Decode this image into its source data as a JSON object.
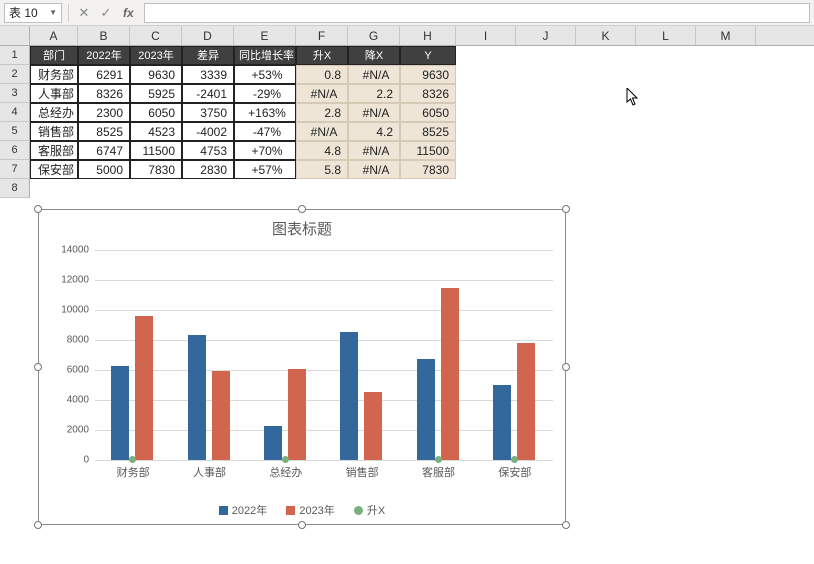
{
  "toolbar": {
    "name_box": "表 10",
    "cancel_icon": "✕",
    "confirm_icon": "✓",
    "fx_label": "fx"
  },
  "columns": [
    "A",
    "B",
    "C",
    "D",
    "E",
    "F",
    "G",
    "H",
    "I",
    "J",
    "K",
    "L",
    "M"
  ],
  "row_headers": [
    "1",
    "2",
    "3",
    "4",
    "5",
    "6",
    "7",
    "8"
  ],
  "headers_main": [
    "部门",
    "2022年",
    "2023年",
    "差异",
    "同比增长率"
  ],
  "headers_right": [
    "升X",
    "降X",
    "Y"
  ],
  "data_main": [
    {
      "dept": "财务部",
      "y22": "6291",
      "y23": "9630",
      "diff": "3339",
      "pct": "+53%"
    },
    {
      "dept": "人事部",
      "y22": "8326",
      "y23": "5925",
      "diff": "-2401",
      "pct": "-29%"
    },
    {
      "dept": "总经办",
      "y22": "2300",
      "y23": "6050",
      "diff": "3750",
      "pct": "+163%"
    },
    {
      "dept": "销售部",
      "y22": "8525",
      "y23": "4523",
      "diff": "-4002",
      "pct": "-47%"
    },
    {
      "dept": "客服部",
      "y22": "6747",
      "y23": "11500",
      "diff": "4753",
      "pct": "+70%"
    },
    {
      "dept": "保安部",
      "y22": "5000",
      "y23": "7830",
      "diff": "2830",
      "pct": "+57%"
    }
  ],
  "data_right": [
    {
      "f": "0.8",
      "g": "#N/A",
      "h": "9630"
    },
    {
      "f": "#N/A",
      "g": "2.2",
      "h": "8326"
    },
    {
      "f": "2.8",
      "g": "#N/A",
      "h": "6050"
    },
    {
      "f": "#N/A",
      "g": "4.2",
      "h": "8525"
    },
    {
      "f": "4.8",
      "g": "#N/A",
      "h": "11500"
    },
    {
      "f": "5.8",
      "g": "#N/A",
      "h": "7830"
    }
  ],
  "chart_data": {
    "type": "bar",
    "title": "图表标题",
    "categories": [
      "财务部",
      "人事部",
      "总经办",
      "销售部",
      "客服部",
      "保安部"
    ],
    "series": [
      {
        "name": "2022年",
        "values": [
          6291,
          8326,
          2300,
          8525,
          6747,
          5000
        ],
        "color": "#32689b"
      },
      {
        "name": "2023年",
        "values": [
          9630,
          5925,
          6050,
          4523,
          11500,
          7830
        ],
        "color": "#d1654e"
      },
      {
        "name": "升X",
        "values": [
          0.8,
          null,
          2.8,
          null,
          4.8,
          5.8
        ],
        "color": "#7ab07d"
      }
    ],
    "xlabel": "",
    "ylabel": "",
    "ylim": [
      0,
      14000
    ],
    "yticks": [
      0,
      2000,
      4000,
      6000,
      8000,
      10000,
      12000,
      14000
    ],
    "grid": true,
    "legend_position": "bottom"
  }
}
